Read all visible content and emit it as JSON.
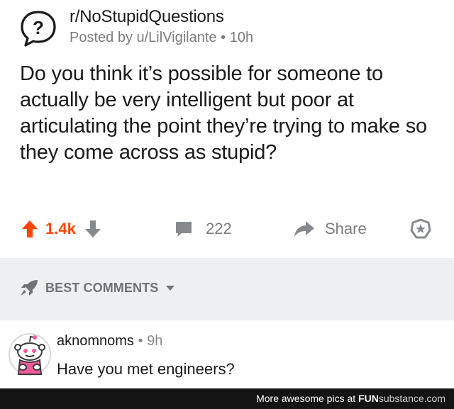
{
  "post": {
    "subreddit": "r/NoStupidQuestions",
    "posted_by": "Posted by u/LilVigilante",
    "dot": "•",
    "time": "10h",
    "title": "Do you think it’s possible for someone to actually be very intelligent but poor at articulating the point they’re trying to make so they come across as stupid?",
    "subreddit_icon": "question-mark-icon"
  },
  "actions": {
    "upvotes": "1.4k",
    "comments": "222",
    "share": "Share"
  },
  "sort": {
    "label": "BEST COMMENTS"
  },
  "comment": {
    "username": "aknomnoms",
    "dot": "•",
    "time": "9h",
    "body": "Have you met engineers?"
  },
  "footer": {
    "prefix": "More awesome pics at ",
    "brand_a": "FUN",
    "brand_b": "substance",
    "suffix": ".com"
  },
  "colors": {
    "upvote": "#ff4500",
    "muted": "#878a8c",
    "sort_bg": "#edeff1",
    "footer_bg": "#141414"
  }
}
